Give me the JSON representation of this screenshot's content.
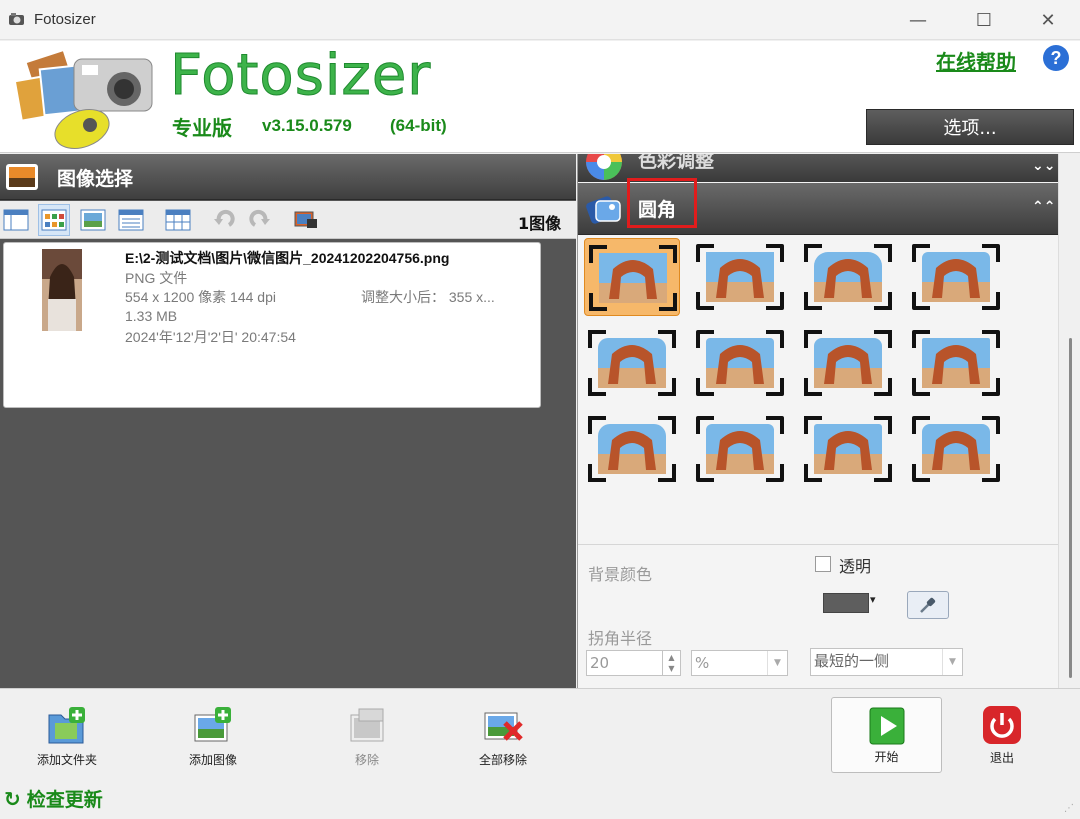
{
  "window": {
    "title": "Fotosizer",
    "minimize": "—",
    "maximize": "☐",
    "close": "✕"
  },
  "header": {
    "brand": "Fotosizer",
    "edition": "专业版",
    "version": "v3.15.0.579",
    "bits": "(64-bit)",
    "help_link": "在线帮助",
    "help_icon": "?",
    "options_button": "选项..."
  },
  "left_panel": {
    "title": "图像选择",
    "image_count": "1图像",
    "toolbar": [
      "view-details-icon",
      "view-thumbnails-icon",
      "view-tiles-icon",
      "view-list-icon",
      "view-table-icon",
      "rotate-left-icon",
      "rotate-right-icon",
      "edit-image-icon"
    ],
    "file": {
      "path": "E:\\2-测试文档\\图片\\微信图片_20241202204756.png",
      "type": "PNG 文件",
      "dims": "554 x 1200 像素 144 dpi",
      "resize": "调整大小后： 355 x...",
      "size": "1.33 MB",
      "date": "2024'年'12'月'2'日' 20:47:54"
    }
  },
  "right_panel": {
    "section_color": "色彩调整",
    "section_corners": "圆角",
    "corner_styles_count": 12,
    "selected_corner_style": 1,
    "settings": {
      "bg_color_label": "背景颜色",
      "transparent_label": "透明",
      "transparent_checked": false,
      "swatch_color": "#5e5e5e",
      "radius_label": "拐角半径",
      "radius_value": "20",
      "unit_value": "%",
      "side_value": "最短的一侧"
    }
  },
  "bottom": {
    "add_folder": "添加文件夹",
    "add_image": "添加图像",
    "remove": "移除",
    "remove_all": "全部移除",
    "start": "开始",
    "exit": "退出",
    "check_update": "检查更新"
  }
}
